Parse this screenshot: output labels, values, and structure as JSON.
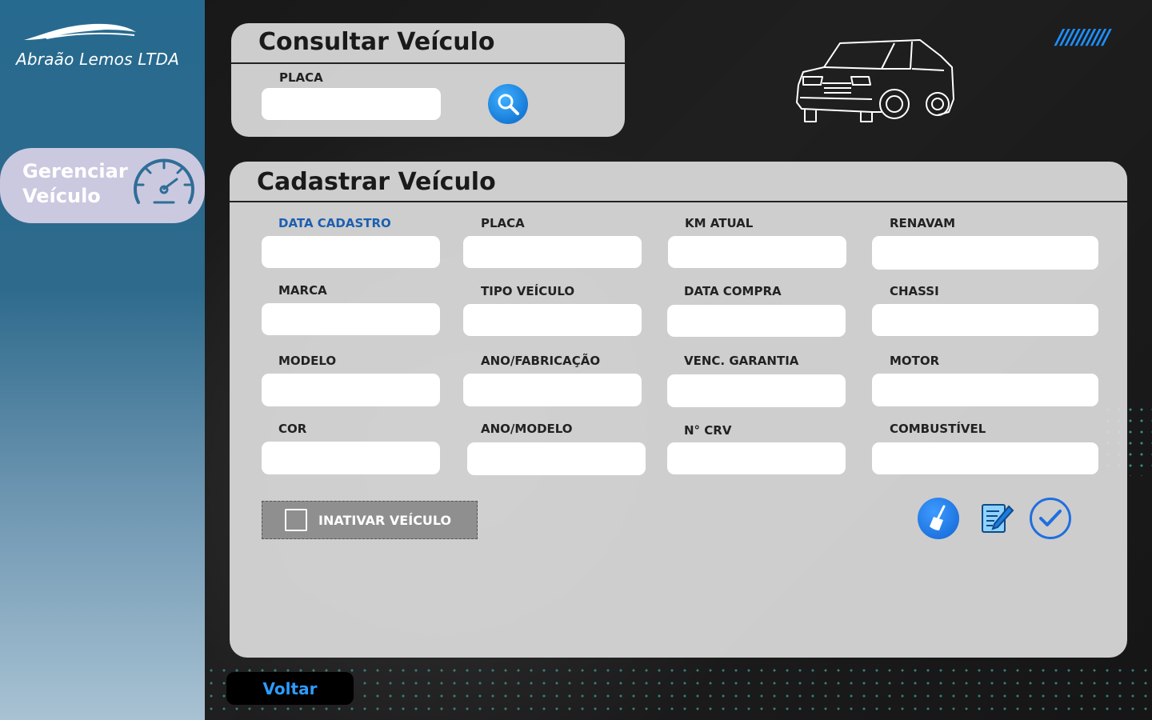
{
  "brand": {
    "name": "Abraão Lemos LTDA",
    "logo_icon": "car-silhouette-icon"
  },
  "sidebar": {
    "items": [
      {
        "label_line1": "Gerenciar",
        "label_line2": "Veículo",
        "icon": "speedometer-icon",
        "active": true
      }
    ]
  },
  "consult": {
    "title": "Consultar Veículo",
    "placa_label": "PLACA",
    "placa_value": "",
    "search_icon": "magnifier-icon"
  },
  "register": {
    "title": "Cadastrar Veículo",
    "fields": {
      "data_cadastro": "DATA CADASTRO",
      "placa": "PLACA",
      "km_atual": "KM ATUAL",
      "renavam": "RENAVAM",
      "marca": "MARCA",
      "tipo_veiculo": "TIPO VEÍCULO",
      "data_compra": "DATA COMPRA",
      "chassi": "CHASSI",
      "modelo": "MODELO",
      "ano_fabricacao": "ANO/FABRICAÇÃO",
      "venc_garantia": "VENC. GARANTIA",
      "motor": "MOTOR",
      "cor": "COR",
      "ano_modelo": "ANO/MODELO",
      "n_crv": "N° CRV",
      "combustivel": "COMBUSTÍVEL"
    },
    "inactivate_label": "INATIVAR VEÍCULO",
    "inactivate_checked": false,
    "actions": {
      "clean_icon": "broom-icon",
      "edit_icon": "edit-note-icon",
      "confirm_icon": "check-circle-icon"
    }
  },
  "footer": {
    "back_label": "Voltar"
  },
  "colors": {
    "sidebar": "#2e6a8c",
    "accent": "#1d5fb0",
    "button_blue": "#1a6fdc",
    "back_text": "#2e9bff"
  }
}
